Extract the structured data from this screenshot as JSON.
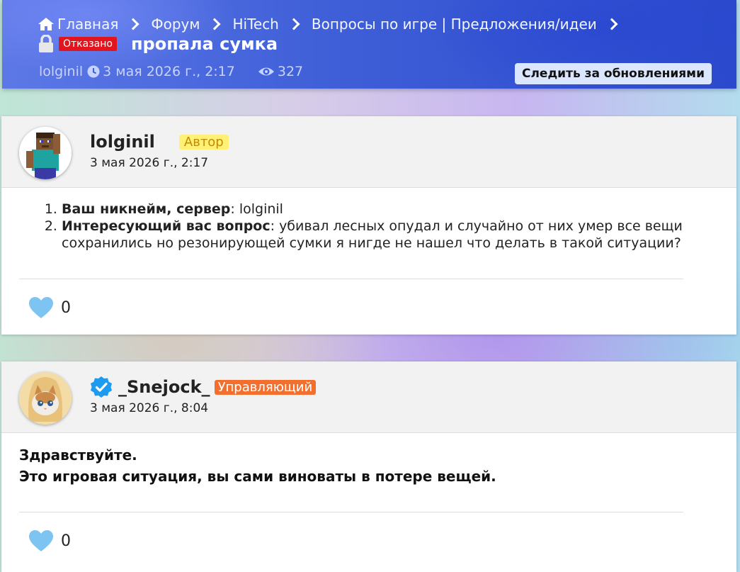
{
  "breadcrumb": [
    "Главная",
    "Форум",
    "HiTech",
    "Вопросы по игре | Предложения/идеи"
  ],
  "thread": {
    "status": "Отказано",
    "title": "пропала сумка",
    "author": "lolginil",
    "date": "3 мая 2026 г., 2:17",
    "views": "327",
    "follow_label": "Следить за обновлениями"
  },
  "posts": [
    {
      "author": "lolginil",
      "badge": "Автор",
      "date": "3 мая 2026 г., 2:17",
      "items": [
        {
          "label": "Ваш никнейм, сервер",
          "text": ": lolginil"
        },
        {
          "label": "Интересующий вас вопрос",
          "text": ": убивал лесных опудал и случайно от них умер все вещи сохранились но резонирующей сумки я нигде не нашел что делать в такой ситуации?"
        }
      ],
      "likes": "0"
    },
    {
      "author": "_Snejock_",
      "badge": "Управляющий",
      "date": "3 мая 2026 г., 8:04",
      "lines": [
        "Здравствуйте.",
        "Это игровая ситуация, вы сами виноваты в потере вещей."
      ],
      "likes": "0"
    }
  ],
  "icons": {
    "home": "home-icon",
    "lock": "lock-icon",
    "clock": "clock-icon",
    "eye": "eye-icon",
    "verified": "verified-icon",
    "heart": "heart-icon"
  },
  "colors": {
    "header_blue": "#3f5fd8",
    "status_red": "#e0151d",
    "author_badge_bg": "#fff176",
    "manager_badge_bg": "#f36f2e",
    "verified_blue": "#1d9bf0",
    "heart": "#7ec4f2"
  }
}
